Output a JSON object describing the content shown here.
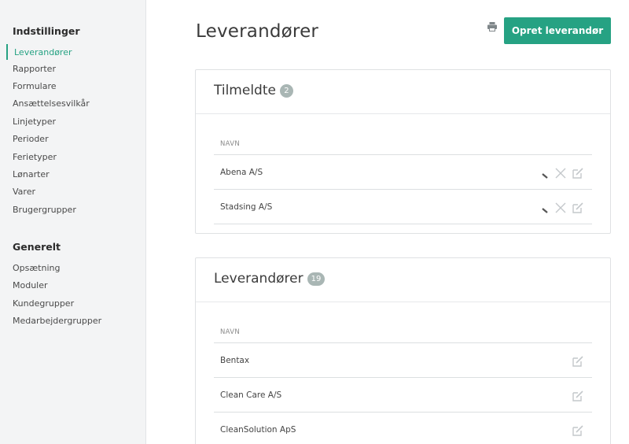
{
  "sidebar": {
    "settings_heading": "Indstillinger",
    "settings_items": [
      {
        "label": "Leverandører",
        "active": true
      },
      {
        "label": "Rapporter"
      },
      {
        "label": "Formulare"
      },
      {
        "label": "Ansættelsesvilkår"
      },
      {
        "label": "Linjetyper"
      },
      {
        "label": "Perioder"
      },
      {
        "label": "Ferietyper"
      },
      {
        "label": "Lønarter"
      },
      {
        "label": "Varer"
      },
      {
        "label": "Brugergrupper"
      }
    ],
    "general_heading": "Generelt",
    "general_items": [
      {
        "label": "Opsætning"
      },
      {
        "label": "Moduler"
      },
      {
        "label": "Kundegrupper"
      },
      {
        "label": "Medarbejdergrupper"
      }
    ]
  },
  "header": {
    "title": "Leverandører",
    "create_button": "Opret leverandør",
    "print_icon": "print-icon"
  },
  "registered": {
    "title": "Tilmeldte",
    "count": "2",
    "column": "NAVN",
    "rows": [
      "Abena A/S",
      "Stadsing A/S"
    ],
    "row_icons": [
      "pencil-icon",
      "close-icon",
      "edit-icon"
    ]
  },
  "suppliers": {
    "title": "Leverandører",
    "count": "19",
    "column": "NAVN",
    "rows": [
      "Bentax",
      "Clean Care A/S",
      "CleanSolution ApS"
    ],
    "row_icons": [
      "edit-icon"
    ]
  },
  "colors": {
    "accent": "#26a283",
    "badge": "#a9b6b4",
    "sidebar_bg": "#f3f4f5",
    "icon_gray": "#c4c8cb"
  }
}
